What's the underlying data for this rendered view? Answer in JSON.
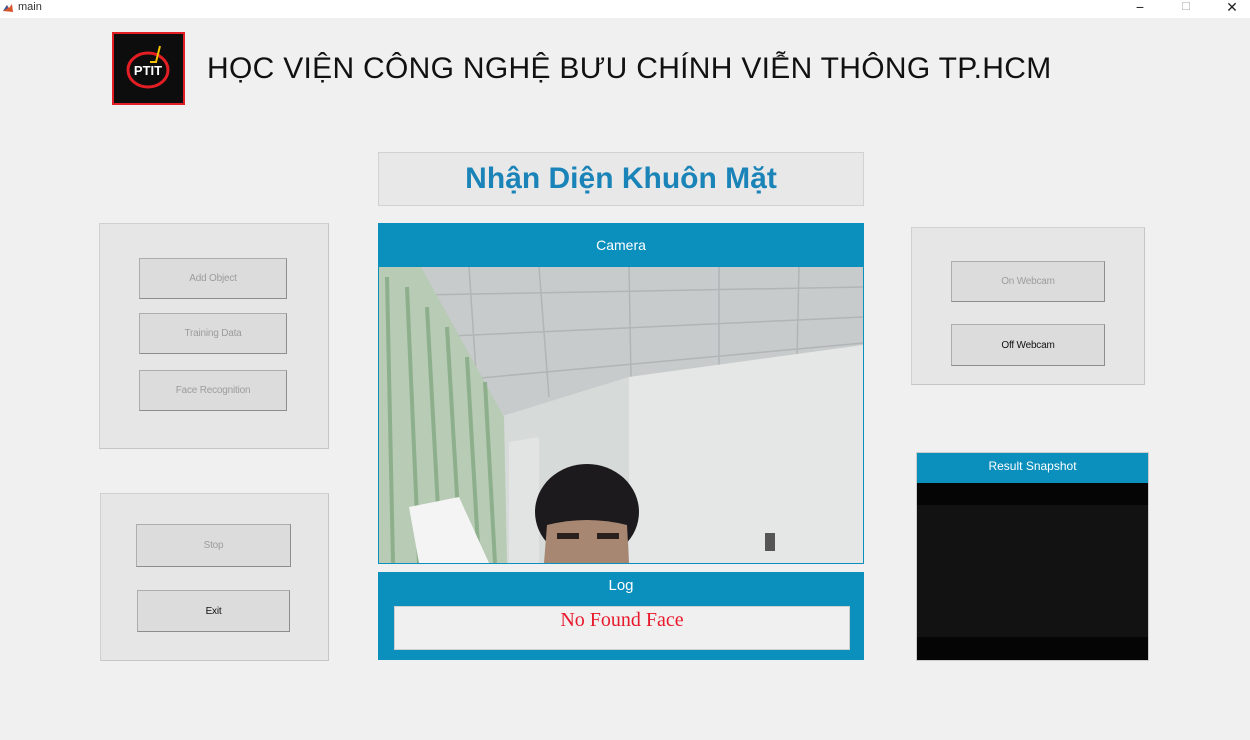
{
  "window": {
    "title": "main"
  },
  "header": {
    "institution": "HỌC VIỆN CÔNG NGHỆ BƯU CHÍNH VIỄN THÔNG TP.HCM"
  },
  "logo": {
    "text": "PTIT"
  },
  "main_title": "Nhận Diện Khuôn Mặt",
  "left_panel": {
    "add_object": "Add Object",
    "training_data": "Training Data",
    "face_recognition": "Face Recognition"
  },
  "control_panel": {
    "stop": "Stop",
    "exit": "Exit"
  },
  "camera": {
    "label": "Camera"
  },
  "log": {
    "label": "Log",
    "message": "No Found Face"
  },
  "webcam_panel": {
    "on": "On Webcam",
    "off": "Off Webcam"
  },
  "snapshot": {
    "label": "Result Snapshot"
  },
  "colors": {
    "accent": "#0b8fbd",
    "title": "#1a84b8",
    "log_text": "#e8192c"
  }
}
